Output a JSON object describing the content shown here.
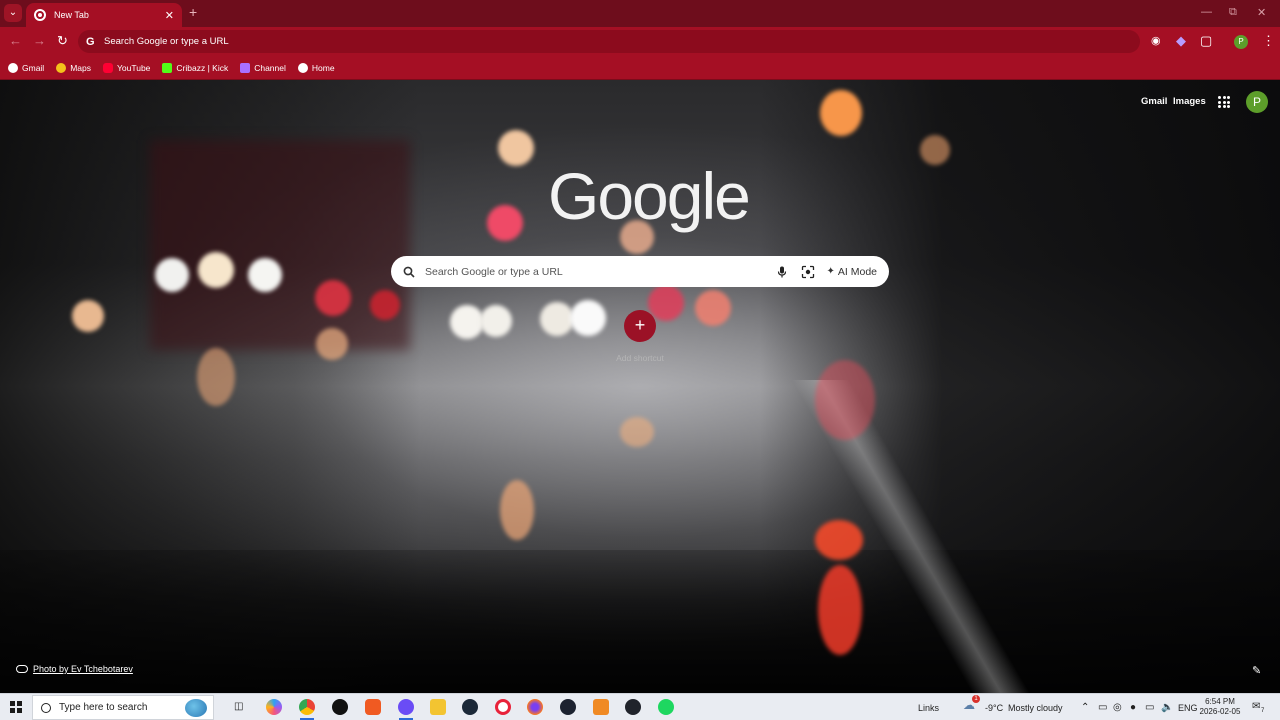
{
  "browser": {
    "tab": {
      "title": "New Tab"
    },
    "omnibox": {
      "placeholder": "Search Google or type a URL"
    },
    "profile_initial": "P",
    "bookmarks": [
      {
        "label": "Gmail",
        "icon": "gmail-icon",
        "color": "#ffffff"
      },
      {
        "label": "Maps",
        "icon": "maps-icon",
        "color": "#f4c21b"
      },
      {
        "label": "YouTube",
        "icon": "youtube-icon",
        "color": "#ff0033"
      },
      {
        "label": "Cribazz | Kick",
        "icon": "kick-icon",
        "color": "#53fc18"
      },
      {
        "label": "Channel",
        "icon": "channel-icon",
        "color": "#a970ff"
      },
      {
        "label": "Home",
        "icon": "home-icon",
        "color": "#ffffff"
      }
    ],
    "theme_color": "#a50f24"
  },
  "ntp": {
    "header_links": {
      "gmail": "Gmail",
      "images": "Images"
    },
    "avatar_initial": "P",
    "logo_text": "Google",
    "search_placeholder": "Search Google or type a URL",
    "ai_mode_label": "AI Mode",
    "add_shortcut_label": "Add shortcut",
    "photo_credit": "Photo by Ev Tchebotarev"
  },
  "taskbar": {
    "search_placeholder": "Type here to search",
    "links_label": "Links",
    "weather": {
      "temp": "-9°C",
      "condition": "Mostly cloudy",
      "alert_count": "1"
    },
    "language": "ENG",
    "time": "6:54 PM",
    "date": "2026-02-05",
    "notification_count": "7"
  }
}
